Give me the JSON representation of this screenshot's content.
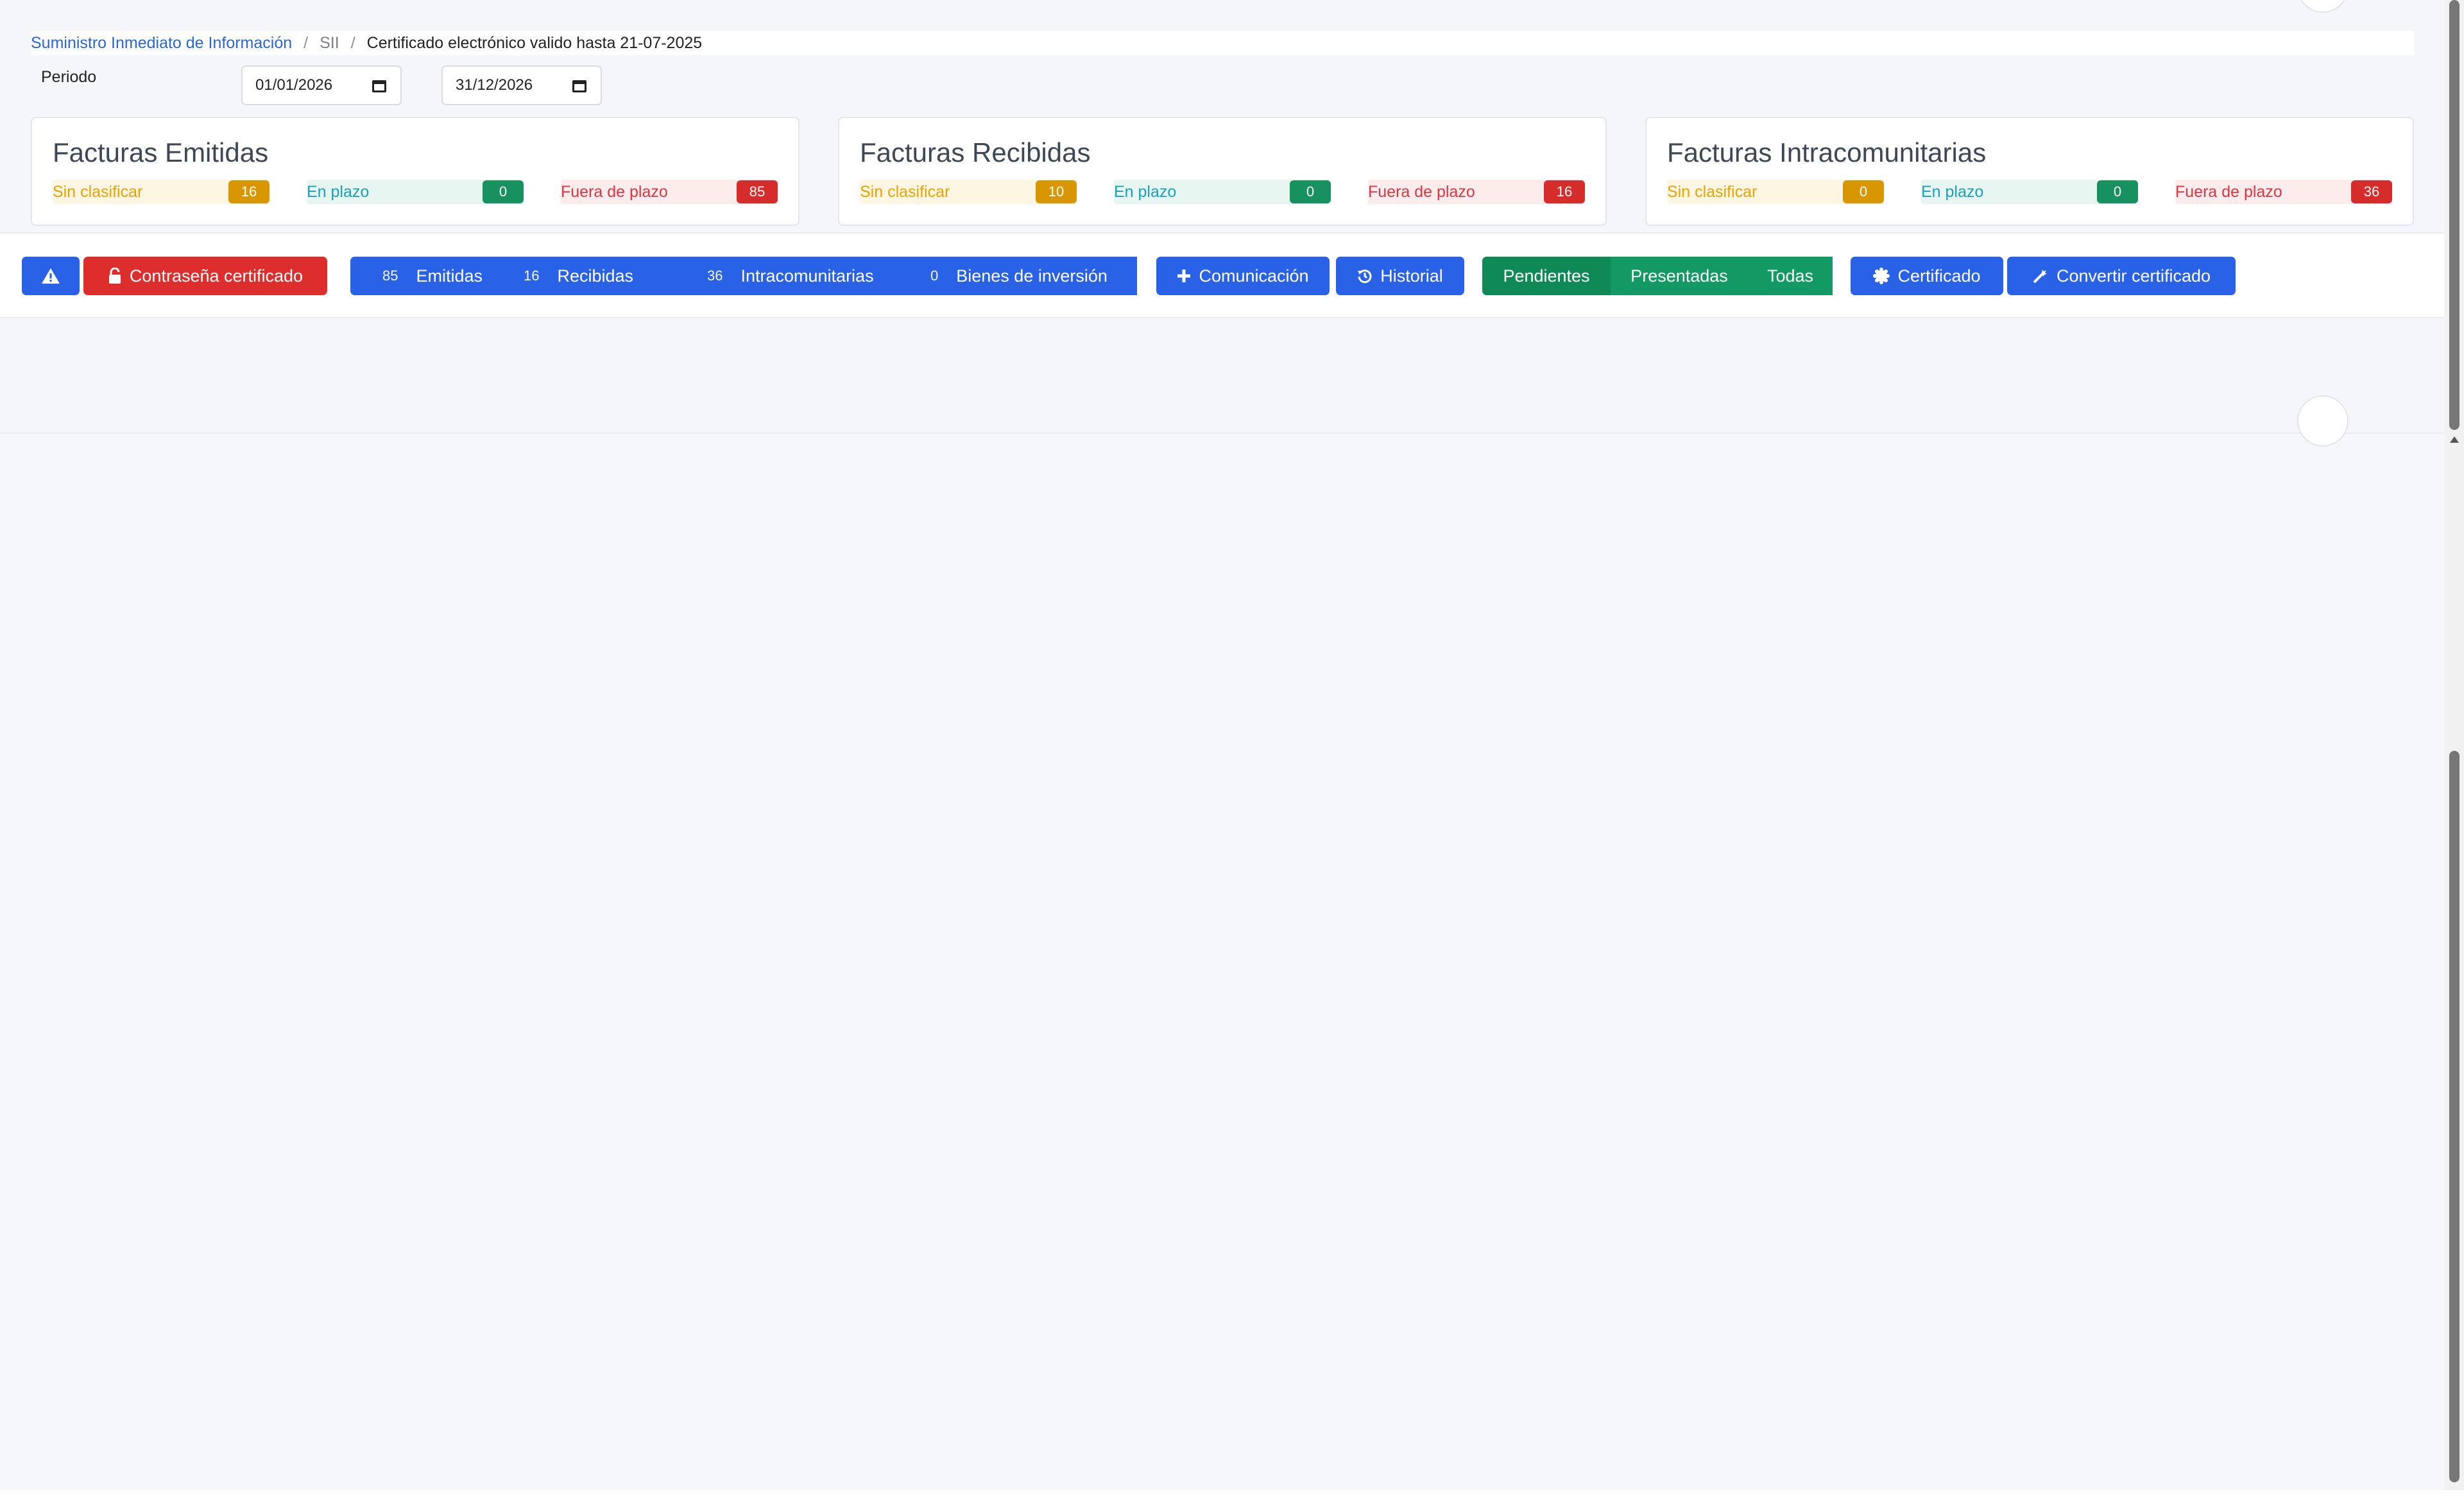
{
  "breadcrumb": {
    "root": "Suministro Inmediato de Información",
    "sep1": "/",
    "middle": "SII",
    "sep2": "/",
    "current": "Certificado electrónico valido hasta 21-07-2025"
  },
  "periodo": {
    "label": "Periodo",
    "from": "01/01/2026",
    "to": "31/12/2026"
  },
  "cards": [
    {
      "title": "Facturas Emitidas",
      "stats": [
        {
          "label": "Sin clasificar",
          "count": "16"
        },
        {
          "label": "En plazo",
          "count": "0"
        },
        {
          "label": "Fuera de plazo",
          "count": "85"
        }
      ]
    },
    {
      "title": "Facturas Recibidas",
      "stats": [
        {
          "label": "Sin clasificar",
          "count": "10"
        },
        {
          "label": "En plazo",
          "count": "0"
        },
        {
          "label": "Fuera de plazo",
          "count": "16"
        }
      ]
    },
    {
      "title": "Facturas Intracomunitarias",
      "stats": [
        {
          "label": "Sin clasificar",
          "count": "0"
        },
        {
          "label": "En plazo",
          "count": "0"
        },
        {
          "label": "Fuera de plazo",
          "count": "36"
        }
      ]
    }
  ],
  "toolbar": {
    "alert_icon": "warning-icon",
    "password_label": "Contraseña certificado",
    "password_icon": "lock-icon",
    "types": [
      {
        "count": "85",
        "label": "Emitidas"
      },
      {
        "count": "16",
        "label": "Recibidas"
      },
      {
        "count": "36",
        "label": "Intracomunitarias"
      },
      {
        "count": "0",
        "label": "Bienes de inversión"
      }
    ],
    "comunicacion_label": "Comunicación",
    "comunicacion_icon": "plus-icon",
    "historial_label": "Historial",
    "historial_icon": "history-icon",
    "filters": [
      "Pendientes",
      "Presentadas",
      "Todas"
    ],
    "certificado_label": "Certificado",
    "certificado_icon": "certificate-icon",
    "convertir_label": "Convertir certificado",
    "convertir_icon": "wand-icon"
  },
  "colors": {
    "primary": "#2962e6",
    "danger": "#de2d2d",
    "success": "#139a64",
    "warning": "#d89600"
  }
}
